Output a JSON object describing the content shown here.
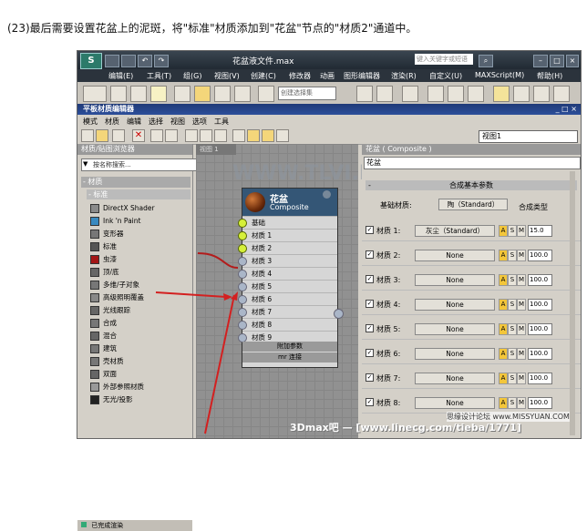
{
  "caption": "(23)最后需要设置花盆上的泥斑，将\"标准\"材质添加到\"花盆\"节点的\"材质2\"通道中。",
  "max": {
    "file_title": "花盆液文件.max",
    "search_placeholder": "键入关键字或短语",
    "menu": [
      "编辑(E)",
      "工具(T)",
      "组(G)",
      "视图(V)",
      "创建(C)",
      "修改器",
      "动画",
      "图形编辑器",
      "渲染(R)",
      "自定义(U)",
      "MAXScript(M)",
      "帮助(H)"
    ],
    "selection_set": "创建选择集"
  },
  "sme": {
    "title": "平板材质编辑器",
    "menu": [
      "模式",
      "材质",
      "编辑",
      "选择",
      "视图",
      "选项",
      "工具"
    ],
    "view_select": "视图1",
    "browser_header": "材质/贴图浏览器",
    "search_placeholder": "按名称搜索...",
    "category": "- 材质",
    "subcategory": "- 标准",
    "items": [
      "DirectX Shader",
      "Ink 'n Paint",
      "变形器",
      "标准",
      "虫漆",
      "顶/底",
      "多维/子对象",
      "高级照明覆盖",
      "光线跟踪",
      "合成",
      "混合",
      "建筑",
      "壳材质",
      "双面",
      "外部参照材质",
      "无光/投影"
    ],
    "status": "已完成渲染",
    "view_tab": "视图 1",
    "node": {
      "name": "花盆",
      "type": "Composite",
      "slots": [
        "基础",
        "材质 1",
        "材质 2",
        "材质 3",
        "材质 4",
        "材质 5",
        "材质 6",
        "材质 7",
        "材质 8",
        "材质 9"
      ],
      "rollups": [
        "附加参数",
        "mr 连接"
      ]
    },
    "param_header": "花盆  ( Composite )",
    "param_name": "花盆",
    "rollout": "合成基本参数",
    "base_label": "基础材质:",
    "base_value": "陶（Standard）",
    "composite_type": "合成类型",
    "materials": [
      {
        "label": "材质 1:",
        "value": "灰尘（Standard）",
        "amount": "15.0"
      },
      {
        "label": "材质 2:",
        "value": "None",
        "amount": "100.0"
      },
      {
        "label": "材质 3:",
        "value": "None",
        "amount": "100.0"
      },
      {
        "label": "材质 4:",
        "value": "None",
        "amount": "100.0"
      },
      {
        "label": "材质 5:",
        "value": "None",
        "amount": "100.0"
      },
      {
        "label": "材质 6:",
        "value": "None",
        "amount": "100.0"
      },
      {
        "label": "材质 7:",
        "value": "None",
        "amount": "100.0"
      },
      {
        "label": "材质 8:",
        "value": "None",
        "amount": "100.0"
      }
    ],
    "asm": [
      "A",
      "S",
      "M"
    ]
  },
  "watermarks": {
    "mid": "WWW.TLVI.NET",
    "bottom": "3Dmax吧 — [www.linecg.com/tieba/1771]",
    "corner": "思缘设计论坛 www.MISSYUAN.COM"
  }
}
